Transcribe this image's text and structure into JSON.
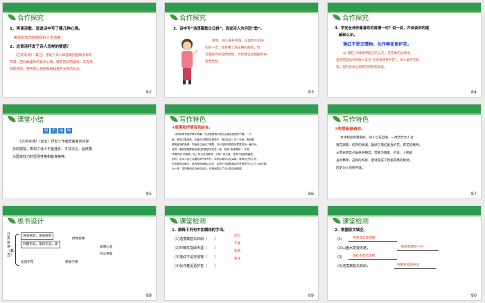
{
  "slides": [
    {
      "title": "合作探究",
      "number": "82",
      "q1": "1．再读诗歌，说说诗中写了哪几种心境。",
      "a1": "离别的忧伤和积极的人生态度。",
      "q2": "2．这首诗抒发了诗人怎样的情感？",
      "a2": [
        "《己亥杂诗》（其五）抒发了诗人辞官离别国家多年的",
        "京城，回归故里时的复杂心情，既有回归的喜悦，又有离",
        "别的感伤，更有忠心报国和继续报务乡民的信念。"
      ]
    },
    {
      "title": "合作探究",
      "number": "83",
      "q": "3．诗中写“浩荡离愁白日斜”，说说诗人为何而“愁”。",
      "a": [
        "离愁：诗人离开京城，正是鸦片战争",
        "的前一年，处目睹了清王朝的腐朽，忧",
        "为国家的命运而忧愁，为好建议治理国的命",
        "运而忧愁。"
      ]
    },
    {
      "title": "合作探究",
      "number": "84",
      "q": [
        "4．学完全诗你最喜欢的是哪一句？说一说，并谈谈你的理",
        "解和认识。"
      ],
      "quote": "落红不是无情物，化作春泥更护花。",
      "a": [
        "以“落红”为喻表明自己的心志，在形象的比喻中，",
        "自然而又贴切地融入议论“化作春泥更护花”。诗人虽然已辞",
        "官，但仍会关心国家的前途和命运。"
      ]
    },
    {
      "title": "课堂小结",
      "number": "85",
      "books": [
        "知",
        "识",
        "结",
        "构"
      ],
      "para": [
        "《己亥杂诗》（其五）抒发了作者辞官离京时复",
        "杂的感情，表现了诗人不畏挫折、不甘沉沦、始终要",
        "为国家效力的坚强性格和献身精神。"
      ]
    },
    {
      "title": "写作特色",
      "number": "86",
      "heading": "①叙事和抒情有机结合。",
      "para": [
        "诗的前两句既抒情又叙事，在无限感慨中表达出豪放洒脱的气概。一方",
        "面，离别之愁浩荡，毕竟自己寓居京城多年，故友如云；另一方面，离别是",
        "脱离官场的束缚，毕竟自己途出了便是，可以回到开森的世界里另有一番作为。",
        "这样，离别的感情就和回归的喜悦交织在一起，既有“浩荡离愁”，又有“",
        "吟鞭东指”的愉快。后二句为自然景物，又有广阔天涯。这两个画面很豪放，",
        "到时，走诗人自己以捷的身份来写作，诗的后两句以花朵喻，表明自己的心志，",
        "在形象的比喻中，自然而然地融入议论，这首十诗将脱离后的思想表白与之个人经历融",
        "为一体，将抒情和议论有机结合，形象地表达了诗人复杂的情感。"
      ]
    },
    {
      "title": "写作特色",
      "number": "87",
      "heading": "②构思新颖奇妙。",
      "para": [
        "本诗构思新颖奇妙，诗人以花自喻，一改历代文人对",
        "落花凋零、伤怀的情调，歌颂了落红献身护花，育花的精神，",
        "从而表明自己虽离开朝廷，但愿为国家、社会、人民献",
        "身的精神。这样的构思，使诗变成了积极昂扬的格调，",
        "历史为人的所传诵。"
      ]
    },
    {
      "title": "板书设计",
      "number": "88",
      "vertical": "己亥杂诗（其五）",
      "lines": [
        "浩荡离愁，浩荡离愁",
        "吟鞭东指，落日天涯，即",
        "落红不是无情物",
        "抒情叙事",
        "表明心志",
        "甘心奉献",
        "化泥护花",
        "移情于物"
      ]
    },
    {
      "title": "课堂检测",
      "number": "89",
      "q": "1．解释下列句中加横线的字词。",
      "items": [
        "(1)浩荡离愁白日斜（　　）",
        "(2)吟鞭东指即天涯（　　）",
        "(3)落红不是无情物（　　）",
        "(4)化作春泥更护花（　　）"
      ],
      "answers": [
        "因为",
        "不要",
        "知道",
        "落花"
      ]
    },
    {
      "title": "课堂检测",
      "number": "90",
      "q": "2．根据原文填空。",
      "items": [
        "(1)",
        "(2)山重水复疑无路，",
        "(3)",
        "(4)浩荡离愁白日斜，"
      ],
      "answers": [
        "不畏浮云遮望眼",
        "柳暗花明又一村",
        "落红不是无情物",
        "吟鞭东指即天涯"
      ]
    }
  ]
}
